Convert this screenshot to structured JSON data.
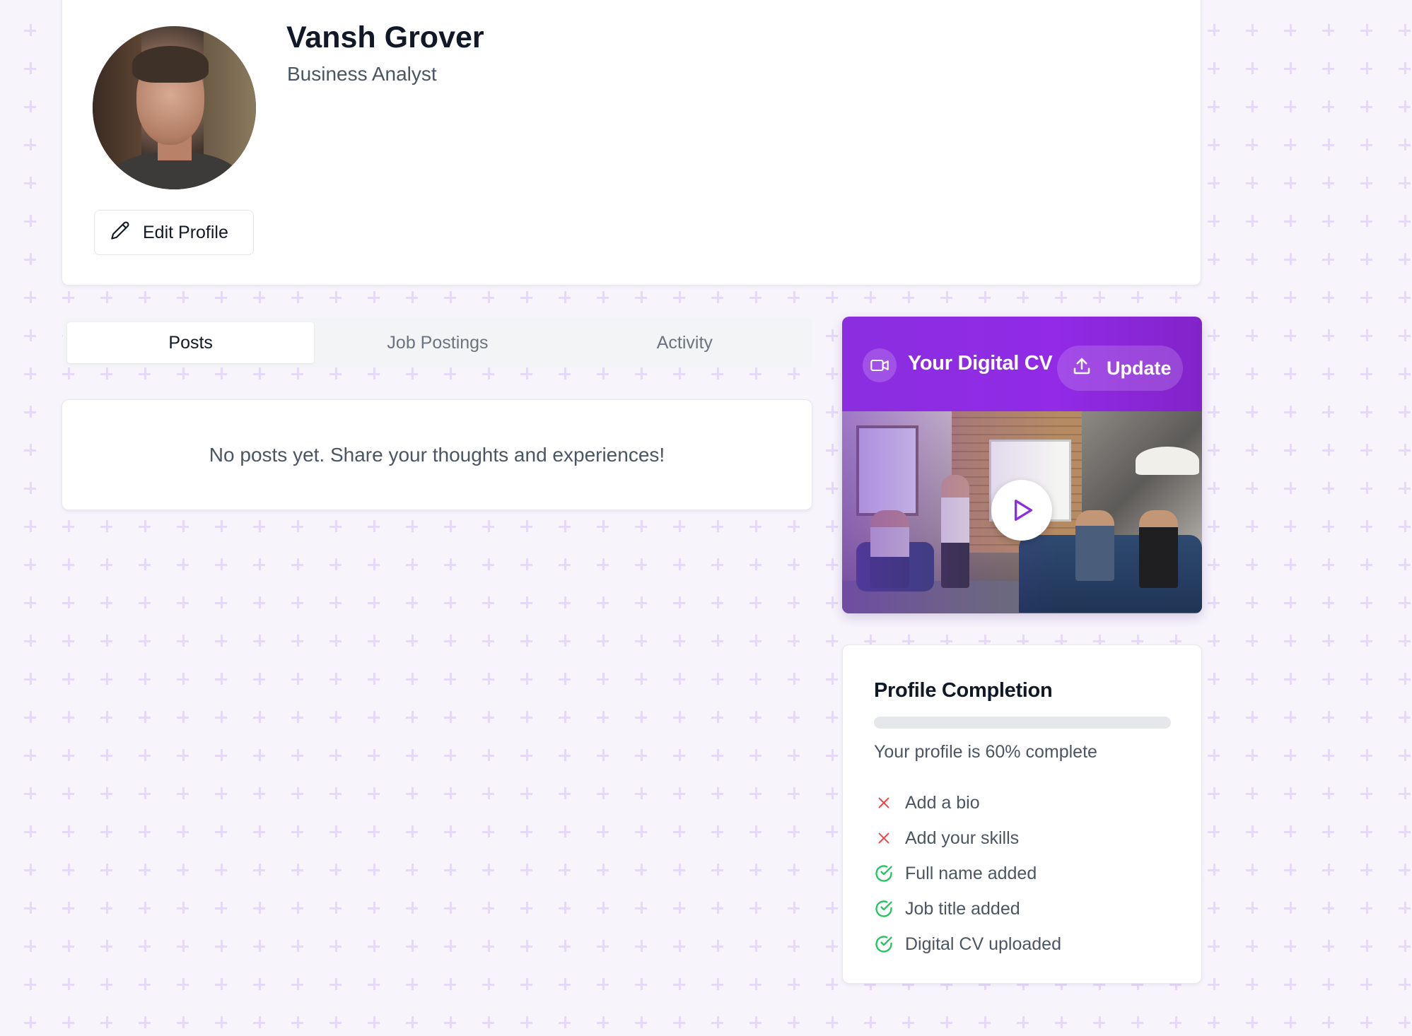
{
  "profile": {
    "name": "Vansh Grover",
    "title": "Business Analyst",
    "edit_label": "Edit Profile"
  },
  "tabs": [
    {
      "label": "Posts",
      "active": true
    },
    {
      "label": "Job Postings",
      "active": false
    },
    {
      "label": "Activity",
      "active": false
    }
  ],
  "posts": {
    "empty_message": "No posts yet. Share your thoughts and experiences!"
  },
  "digital_cv": {
    "title": "Your Digital CV",
    "update_label": "Update"
  },
  "completion": {
    "title": "Profile Completion",
    "progress_percent": 60,
    "summary": "Your profile is 60% complete",
    "items": [
      {
        "label": "Add a bio",
        "done": false
      },
      {
        "label": "Add your skills",
        "done": false
      },
      {
        "label": "Full name added",
        "done": true
      },
      {
        "label": "Job title added",
        "done": true
      },
      {
        "label": "Digital CV uploaded",
        "done": true
      }
    ]
  },
  "colors": {
    "accent": "#8b2ee2",
    "done": "#22c55e",
    "todo": "#ef4444",
    "background": "#f7f4fc"
  },
  "icons": {
    "edit": "pencil-icon",
    "video": "video-camera-icon",
    "upload": "upload-icon",
    "play": "play-icon",
    "todo": "x-icon",
    "done": "check-circle-icon"
  }
}
